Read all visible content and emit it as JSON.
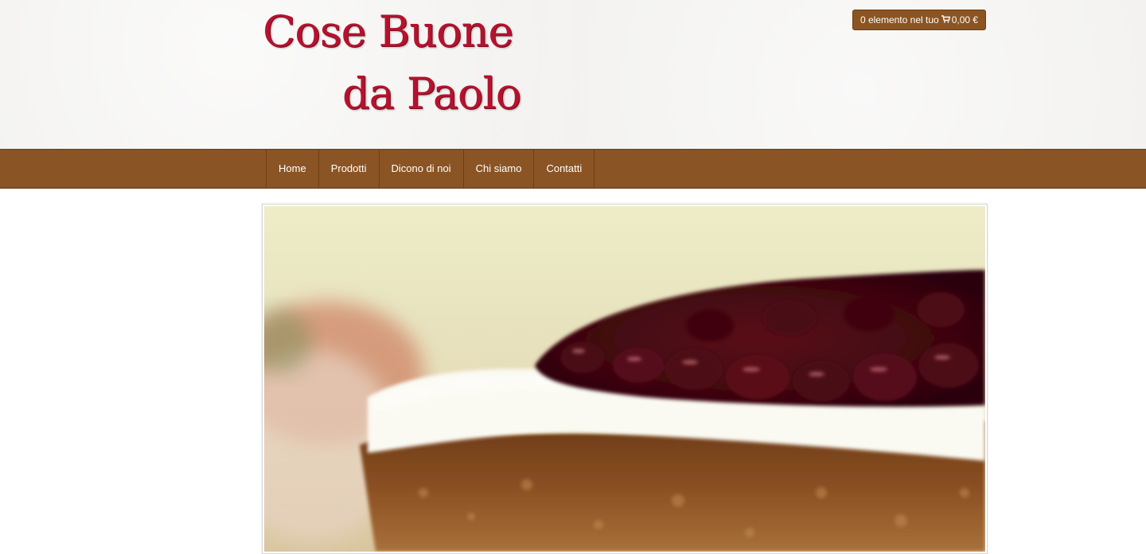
{
  "header": {
    "logo": {
      "line1": "Cose Buone",
      "line2": "da Paolo"
    },
    "cart": {
      "text": "0 elemento nel tuo",
      "icon": "shopping-cart-icon",
      "amount": "0,00 €"
    }
  },
  "nav": {
    "items": [
      {
        "label": "Home"
      },
      {
        "label": "Prodotti"
      },
      {
        "label": "Dicono di noi"
      },
      {
        "label": "Chi siamo"
      },
      {
        "label": "Contatti"
      }
    ]
  },
  "hero": {
    "subject": "cake with cherry jam and powdered sugar"
  },
  "colors": {
    "brand_brown": "#8b5424",
    "logo_red": "#b5122e",
    "header_bg": "#f1f0ee"
  }
}
